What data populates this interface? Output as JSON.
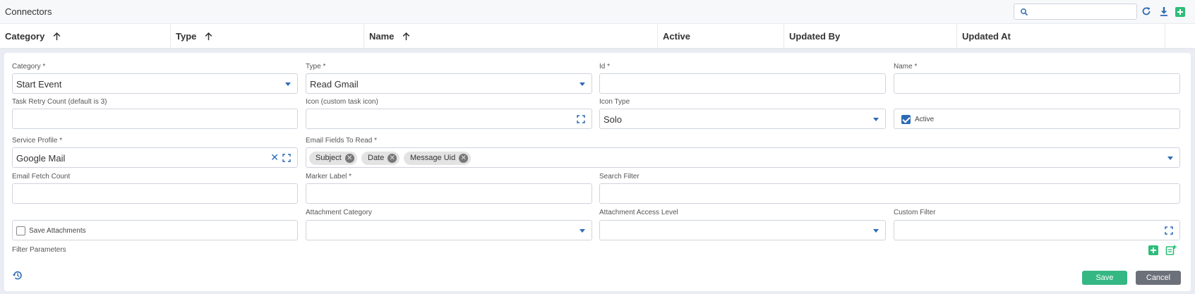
{
  "header": {
    "title": "Connectors",
    "search_placeholder": "",
    "icons": [
      "search-icon",
      "refresh-icon",
      "download-icon",
      "add-icon"
    ]
  },
  "columns": [
    {
      "label": "Category",
      "sorted": true
    },
    {
      "label": "Type",
      "sorted": true
    },
    {
      "label": "Name",
      "sorted": true
    },
    {
      "label": "Active",
      "sorted": false
    },
    {
      "label": "Updated By",
      "sorted": false
    },
    {
      "label": "Updated At",
      "sorted": false
    }
  ],
  "form": {
    "category": {
      "label": "Category *",
      "value": "Start Event"
    },
    "type": {
      "label": "Type *",
      "value": "Read Gmail"
    },
    "id": {
      "label": "Id *",
      "value": ""
    },
    "name": {
      "label": "Name *",
      "value": ""
    },
    "task_retry": {
      "label": "Task Retry Count (default is 3)",
      "value": ""
    },
    "icon": {
      "label": "Icon (custom task icon)",
      "value": ""
    },
    "icon_type": {
      "label": "Icon Type",
      "value": "Solo"
    },
    "active": {
      "label": "Active",
      "checked": true
    },
    "service_profile": {
      "label": "Service Profile *",
      "value": "Google Mail"
    },
    "email_fields": {
      "label": "Email Fields To Read *",
      "chips": [
        "Subject",
        "Date",
        "Message Uid"
      ]
    },
    "email_fetch_count": {
      "label": "Email Fetch Count",
      "value": ""
    },
    "marker_label": {
      "label": "Marker Label *",
      "value": ""
    },
    "search_filter": {
      "label": "Search Filter",
      "value": ""
    },
    "save_attachments": {
      "label": "Save Attachments",
      "checked": false
    },
    "attachment_category": {
      "label": "Attachment Category",
      "value": ""
    },
    "attachment_access": {
      "label": "Attachment Access Level",
      "value": ""
    },
    "custom_filter": {
      "label": "Custom Filter",
      "value": ""
    },
    "filter_parameters": {
      "label": "Filter Parameters"
    }
  },
  "buttons": {
    "save": "Save",
    "cancel": "Cancel"
  },
  "colors": {
    "accent": "#2d6bb5",
    "save": "#35b783",
    "cancel": "#6c7079",
    "add": "#2ebd7a"
  }
}
